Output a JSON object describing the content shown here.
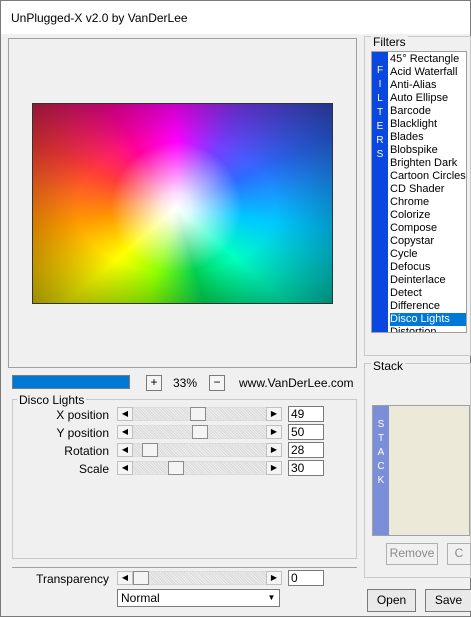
{
  "window": {
    "title": "UnPlugged-X v2.0 by VanDerLee"
  },
  "preview": {
    "zoom": "33%",
    "zoom_in_label": "+",
    "zoom_out_label": "−",
    "website": "www.VanDerLee.com",
    "progress_fraction": 1.0
  },
  "params_group": {
    "title": "Disco Lights",
    "params": [
      {
        "label": "X position",
        "value": "49",
        "slider_fraction": 0.49
      },
      {
        "label": "Y position",
        "value": "50",
        "slider_fraction": 0.5
      },
      {
        "label": "Rotation",
        "value": "28",
        "slider_fraction": 0.08
      },
      {
        "label": "Scale",
        "value": "30",
        "slider_fraction": 0.3
      }
    ]
  },
  "transparency": {
    "label": "Transparency",
    "value": "0",
    "slider_fraction": 0.0
  },
  "blend_mode": {
    "selected": "Normal"
  },
  "filters": {
    "title": "Filters",
    "strip_letters": [
      "F",
      "I",
      "L",
      "T",
      "E",
      "R",
      "S"
    ],
    "items": [
      "45° Rectangle",
      "Acid Waterfall",
      "Anti-Alias",
      "Auto Ellipse",
      "Barcode",
      "Blacklight",
      "Blades",
      "Blobspike",
      "Brighten Dark",
      "Cartoon Circles",
      "CD Shader",
      "Chrome",
      "Colorize",
      "Compose",
      "Copystar",
      "Cycle",
      "Defocus",
      "Deinterlace",
      "Detect",
      "Difference",
      "Disco Lights",
      "Distortion"
    ],
    "selected": "Disco Lights"
  },
  "stack": {
    "title": "Stack",
    "strip_letters": [
      "S",
      "T",
      "A",
      "C",
      "K"
    ],
    "remove_label": "Remove",
    "clear_label": "C"
  },
  "buttons": {
    "open": "Open",
    "save": "Save"
  },
  "colors": {
    "accent": "#0078d7",
    "filters_strip": "#0a47e0",
    "stack_strip": "#7b8ed8"
  },
  "icons": {
    "arrow_left": "◀",
    "arrow_right": "▶",
    "dropdown": "▼"
  }
}
